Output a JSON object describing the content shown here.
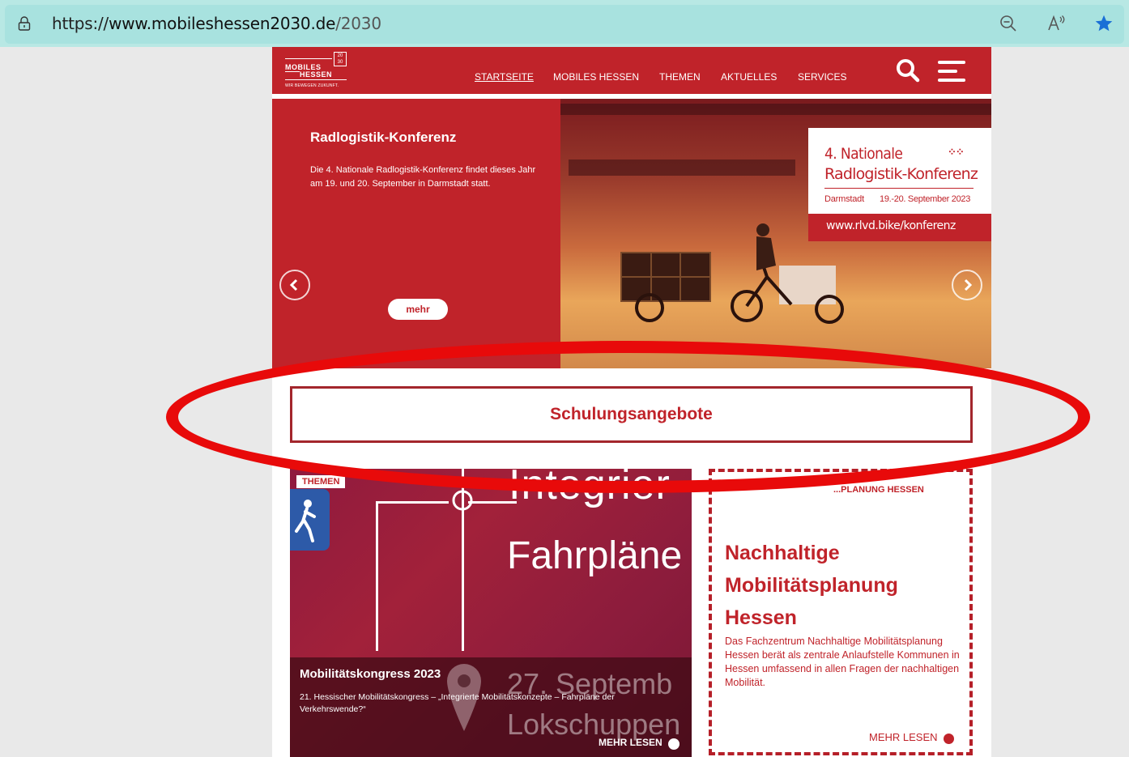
{
  "browser": {
    "url_scheme": "https://",
    "url_host": "www.mobileshessen2030.de",
    "url_path": "/2030",
    "icons": [
      "lock-icon",
      "zoom-out-icon",
      "read-aloud-icon",
      "favorite-star-icon"
    ]
  },
  "header": {
    "logo": {
      "line1": "MOBILES",
      "line2": "HESSEN",
      "badge": "20 30",
      "tagline": "WIR BEWEGEN ZUKUNFT."
    },
    "nav": [
      "STARTSEITE",
      "MOBILES HESSEN",
      "THEMEN",
      "AKTUELLES",
      "SERVICES"
    ],
    "active_nav": "STARTSEITE",
    "icons": [
      "search-icon",
      "menu-icon"
    ]
  },
  "slider": {
    "title": "Radlogistik-Konferenz",
    "text": "Die 4. Nationale Radlogistik-Konferenz findet dieses Jahr am 19. und 20. September in Darmstadt statt.",
    "button": "mehr",
    "promo": {
      "line1": "4. Nationale",
      "line2": "Radlogistik-Konferenz",
      "city": "Darmstadt",
      "date": "19.-20. September 2023",
      "url": "www.rlvd.bike/konferenz"
    }
  },
  "schulung": {
    "label": "Schulungsangebote"
  },
  "card_left": {
    "tag": "THEMEN",
    "image_text1": "Integrier",
    "image_text2": "Fahrpläne",
    "image_text3": "27. Septemb",
    "image_text4": "Lokschuppen",
    "title": "Mobilitätskongress 2023",
    "text": "21. Hessischer Mobilitätskongress – „Integrierte Mobilitätskonzepte – Fahrpläne der Verkehrswende?“",
    "more": "MEHR LESEN"
  },
  "card_right": {
    "label": "...PLANUNG HESSEN",
    "title": "Nachhaltige Mobilitätsplanung Hessen",
    "text": "Das Fachzentrum Nachhaltige Mobilitätsplanung Hessen berät als zentrale Anlaufstelle Kommunen in Hessen umfassend in allen Fragen der nachhaltigen Mobilität.",
    "more": "MEHR LESEN"
  },
  "colors": {
    "brand": "#c0232a",
    "annotation": "#e80a0a",
    "browser_bar": "#a8e2df"
  }
}
